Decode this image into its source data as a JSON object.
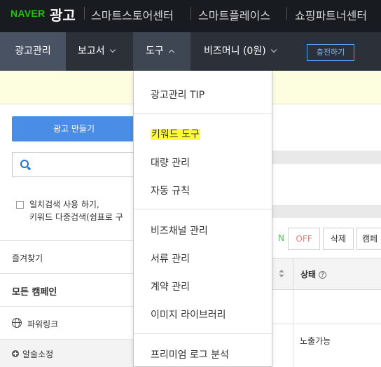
{
  "brand": {
    "naver": "NAVER",
    "title": "광고",
    "links": [
      "스마트스토어센터",
      "스마트플레이스",
      "쇼핑파트너센터"
    ]
  },
  "nav": {
    "ad_manage": "광고관리",
    "report": "보고서",
    "tools": "도구",
    "bizmoney": "비즈머니 (0원)",
    "charge": "충전하기"
  },
  "left": {
    "create_ad": "광고 만들기",
    "option_line1": "일치검색 사용 하기,",
    "option_line2": "키워드 다중검색(쉼표로 구",
    "favorites": "즐겨찾기",
    "all_campaigns": "모든 캠페인",
    "powerlink": "파워링크",
    "alarm": "알술소정"
  },
  "table": {
    "btn_on": "N",
    "btn_off": "OFF",
    "btn_delete": "삭제",
    "btn_campaign": "캠페",
    "col_status": "상태",
    "help_glyph": "?",
    "status_value": "노출가능"
  },
  "dropdown": {
    "items": [
      "광고관리 TIP",
      "키워드 도구",
      "대량 관리",
      "자동 규칙",
      "비즈채널 관리",
      "서류 관리",
      "계약 관리",
      "이미지 라이브러리",
      "프리미엄 로그 분석"
    ]
  },
  "colors": {
    "brand_bar": "#181b20",
    "nav_bar": "#2c3038",
    "naver_green": "#1ec800",
    "primary_button": "#4a8de6",
    "highlight": "#ffff33",
    "off_text": "#e88080",
    "on_text": "#5cb85c"
  }
}
